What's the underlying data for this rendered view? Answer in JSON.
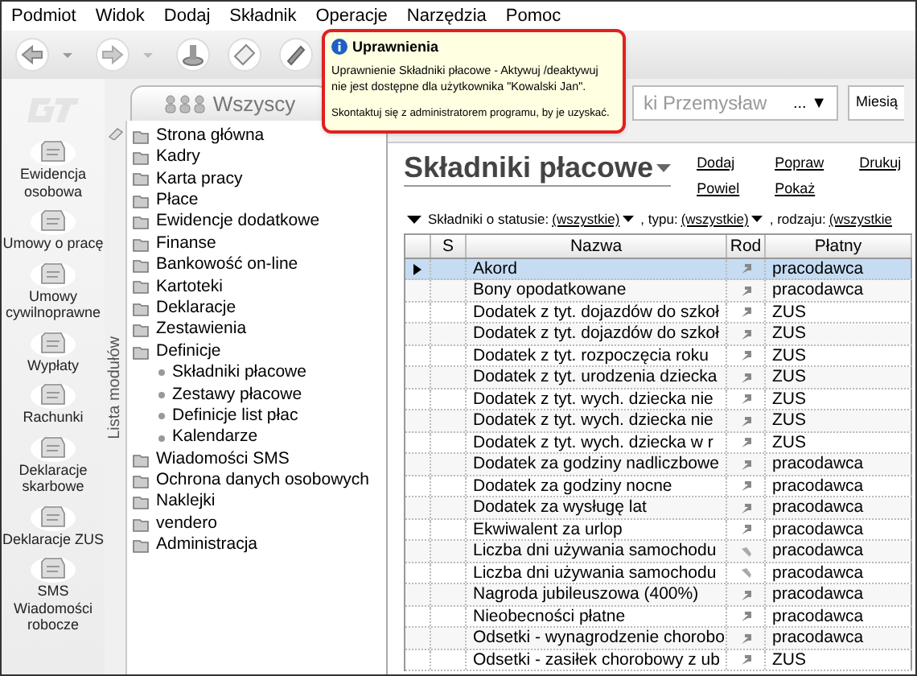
{
  "menu": [
    "Podmiot",
    "Widok",
    "Dodaj",
    "Składnik",
    "Operacje",
    "Narzędzia",
    "Pomoc"
  ],
  "tooltip": {
    "title": "Uprawnienia",
    "message": "Uprawnienie Składniki płacowe - Aktywuj /deaktywuj nie jest dostępne dla użytkownika \"Kowalski Jan\".",
    "hint": "Skontaktuj się z administratorem programu, by je uzyskać."
  },
  "group_tab": {
    "label": "Wszyscy",
    "selected": true
  },
  "employee_combo": {
    "value": "ki Przemysław",
    "button": "...",
    "caret": "▼"
  },
  "period_label": "Miesią",
  "modules": [
    {
      "label": "Ewidencja osobowa"
    },
    {
      "label": "Umowy o pracę"
    },
    {
      "label": "Umowy cywilnoprawne"
    },
    {
      "label": "Wypłaty"
    },
    {
      "label": "Rachunki"
    },
    {
      "label": "Deklaracje skarbowe"
    },
    {
      "label": "Deklaracje ZUS"
    },
    {
      "label": "SMS Wiadomości robocze"
    }
  ],
  "module_strip": "Lista modułów",
  "nav": [
    {
      "label": "Strona główna"
    },
    {
      "label": "Kadry"
    },
    {
      "label": "Karta pracy"
    },
    {
      "label": "Płace"
    },
    {
      "label": "Ewidencje dodatkowe"
    },
    {
      "label": "Finanse"
    },
    {
      "label": "Bankowość on-line"
    },
    {
      "label": "Kartoteki"
    },
    {
      "label": "Deklaracje"
    },
    {
      "label": "Zestawienia"
    },
    {
      "label": "Definicje",
      "children": [
        {
          "label": "Składniki płacowe"
        },
        {
          "label": "Zestawy płacowe"
        },
        {
          "label": "Definicje list płac"
        },
        {
          "label": "Kalendarze"
        }
      ]
    },
    {
      "label": "Wiadomości SMS"
    },
    {
      "label": "Ochrona danych osobowych"
    },
    {
      "label": "Naklejki"
    },
    {
      "label": "vendero"
    },
    {
      "label": "Administracja"
    }
  ],
  "page_title": "Składniki płacowe",
  "actions": [
    [
      "Dodaj",
      "Powiel"
    ],
    [
      "Popraw",
      "Pokaż"
    ],
    [
      "Drukuj"
    ]
  ],
  "filter": {
    "label": "Składniki o statusie:",
    "status": "(wszystkie)",
    "type_label": ", typu:",
    "type": "(wszystkie)",
    "kind_label": ", rodzaju:",
    "kind": "(wszystkie"
  },
  "table": {
    "columns": [
      "S",
      "Nazwa",
      "Rod",
      "Płatny"
    ],
    "rows": [
      {
        "name": "Akord",
        "kind": "arrow",
        "payer": "pracodawca",
        "selected": true
      },
      {
        "name": "Bony opodatkowane",
        "kind": "arrow",
        "payer": "pracodawca",
        "selected": false
      },
      {
        "name": "Dodatek z tyt. dojazdów do szkoł",
        "kind": "arrow",
        "payer": "ZUS",
        "selected": false
      },
      {
        "name": "Dodatek z tyt. dojazdów do szkoł",
        "kind": "arrow",
        "payer": "ZUS",
        "selected": false
      },
      {
        "name": "Dodatek z tyt. rozpoczęcia roku",
        "kind": "arrow",
        "payer": "ZUS",
        "selected": false
      },
      {
        "name": "Dodatek z tyt. urodzenia dziecka",
        "kind": "arrow",
        "payer": "ZUS",
        "selected": false
      },
      {
        "name": "Dodatek z tyt. wych. dziecka nie",
        "kind": "arrow",
        "payer": "ZUS",
        "selected": false
      },
      {
        "name": "Dodatek z tyt. wych. dziecka nie",
        "kind": "arrow",
        "payer": "ZUS",
        "selected": false
      },
      {
        "name": "Dodatek z tyt. wych. dziecka w r",
        "kind": "arrow",
        "payer": "ZUS",
        "selected": false
      },
      {
        "name": "Dodatek za godziny nadliczbowe",
        "kind": "arrow",
        "payer": "pracodawca",
        "selected": false
      },
      {
        "name": "Dodatek za godziny nocne",
        "kind": "arrow",
        "payer": "pracodawca",
        "selected": false
      },
      {
        "name": "Dodatek za wysługę lat",
        "kind": "arrow",
        "payer": "pracodawca",
        "selected": false
      },
      {
        "name": "Ekwiwalent za urlop",
        "kind": "arrow",
        "payer": "pracodawca",
        "selected": false
      },
      {
        "name": "Liczba dni używania samochodu",
        "kind": "tool",
        "payer": "pracodawca",
        "selected": false
      },
      {
        "name": "Liczba dni używania samochodu",
        "kind": "tool",
        "payer": "pracodawca",
        "selected": false
      },
      {
        "name": "Nagroda jubileuszowa (400%)",
        "kind": "arrow",
        "payer": "pracodawca",
        "selected": false
      },
      {
        "name": "Nieobecności płatne",
        "kind": "arrow",
        "payer": "pracodawca",
        "selected": false
      },
      {
        "name": "Odsetki - wynagrodzenie chorobo",
        "kind": "arrow",
        "payer": "pracodawca",
        "selected": false
      },
      {
        "name": "Odsetki - zasiłek chorobowy z ub",
        "kind": "arrow",
        "payer": "ZUS",
        "selected": false
      }
    ]
  }
}
